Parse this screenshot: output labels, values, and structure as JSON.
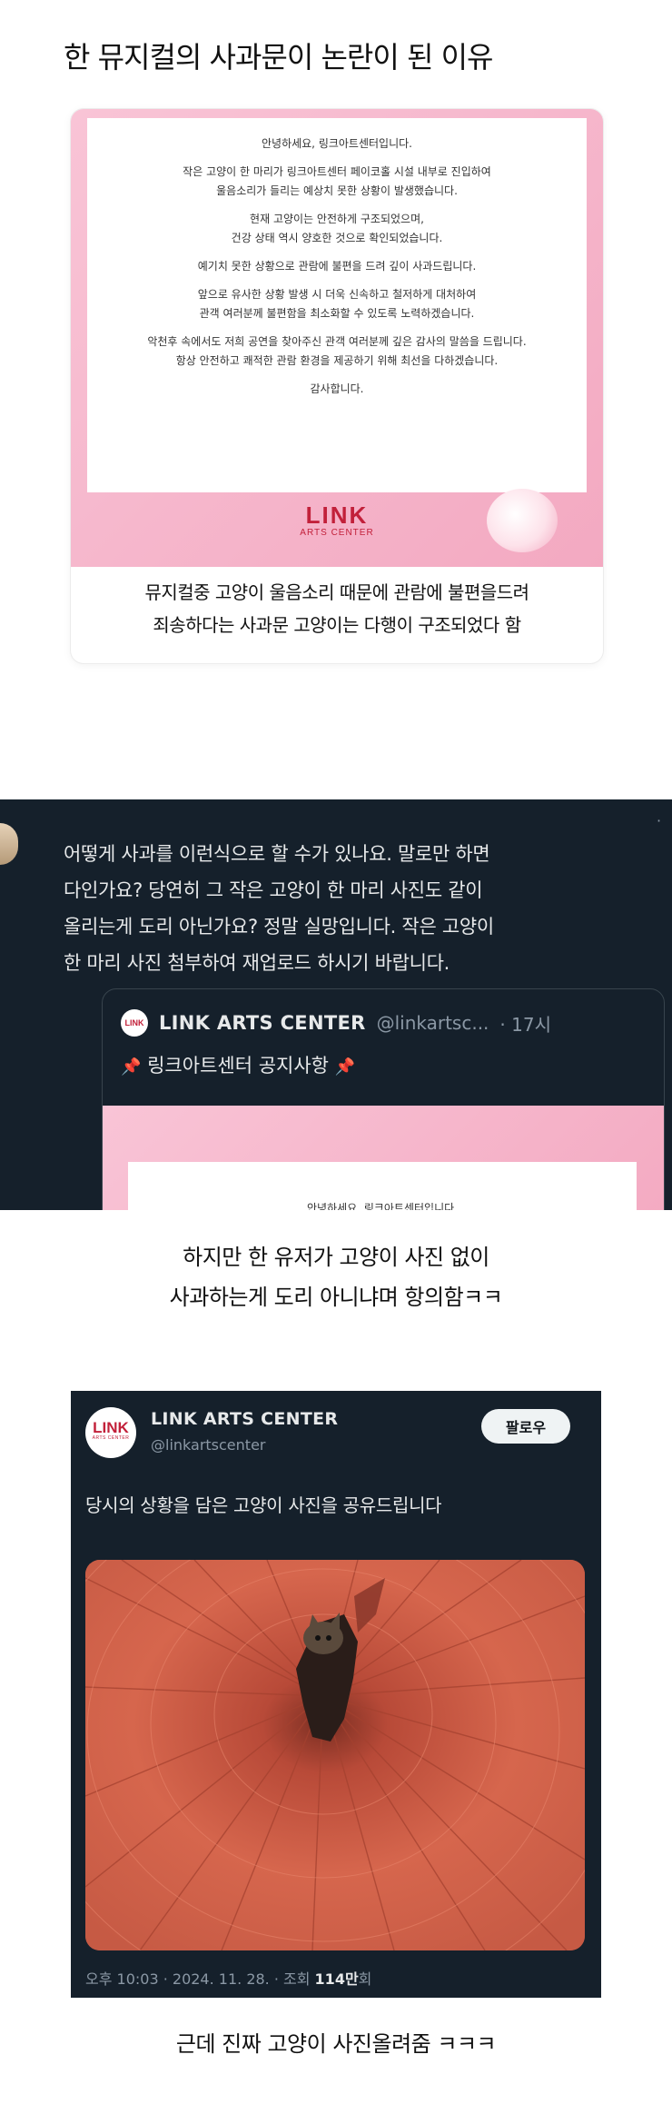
{
  "page_title": "한 뮤지컬의 사과문이 논란이 된 이유",
  "notice": {
    "paragraphs": [
      [
        "안녕하세요, 링크아트센터입니다."
      ],
      [
        "작은 고양이 한 마리가 링크아트센터 페이코홀 시설 내부로 진입하여",
        "울음소리가 들리는 예상치 못한 상황이 발생했습니다."
      ],
      [
        "현재 고양이는 안전하게 구조되었으며,",
        "건강 상태 역시 양호한 것으로 확인되었습니다."
      ],
      [
        "예기치 못한 상황으로 관람에 불편을 드려 깊이 사과드립니다."
      ],
      [
        "앞으로 유사한 상황 발생 시 더욱 신속하고 철저하게 대처하여",
        "관객 여러분께 불편함을 최소화할 수 있도록 노력하겠습니다."
      ],
      [
        "악천후 속에서도 저희 공연을 찾아주신 관객 여러분께 깊은 감사의 말씀을 드립니다.",
        "항상 안전하고 쾌적한 관람 환경을 제공하기 위해 최선을 다하겠습니다."
      ],
      [
        "감사합니다."
      ]
    ],
    "logo_main": "LINK",
    "logo_sub": "ARTS CENTER",
    "caption_lines": [
      "뮤지컬중 고양이 울음소리 때문에 관람에 불편을드려",
      "죄송하다는 사과문 고양이는 다행이 구조되었다 함"
    ]
  },
  "reply": {
    "lines": [
      "어떻게 사과를 이런식으로 할 수가 있나요. 말로만 하면",
      "다인가요? 당연히 그 작은 고양이 한 마리 사진도 같이",
      "올리는게 도리 아닌가요? 정말 실망입니다. 작은 고양이",
      "한 마리 사진 첨부하여 재업로드 하시기 바랍니다."
    ],
    "quote": {
      "avatar_text": "LINK",
      "name": "LINK ARTS CENTER",
      "handle": "@linkartsc...",
      "time": "· 17시",
      "pin_icon": "📌",
      "subtitle": "링크아트센터 공지사항",
      "preview_text": "안녕하세요, 링크아트센터입니다."
    }
  },
  "caption2_lines": [
    "하지만 한 유저가 고양이 사진 없이",
    "사과하는게 도리 아니냐며 항의함ㅋㅋ"
  ],
  "tweet": {
    "avatar_main": "LINK",
    "avatar_sub": "ARTS CENTER",
    "name": "LINK ARTS CENTER",
    "handle": "@linkartscenter",
    "follow_label": "팔로우",
    "body": "당시의 상황을 담은 고양이 사진을 공유드립니다",
    "meta_time": "오후 10:03 · 2024. 11. 28. · 조회 ",
    "meta_views": "114만",
    "meta_suffix": "회"
  },
  "caption3": "근데 진짜 고양이 사진올려줌 ㅋㅋㅋ",
  "colors": {
    "brand_red": "#c2203a",
    "dark_bg": "#15202b",
    "pink": "#f6b8cd"
  }
}
